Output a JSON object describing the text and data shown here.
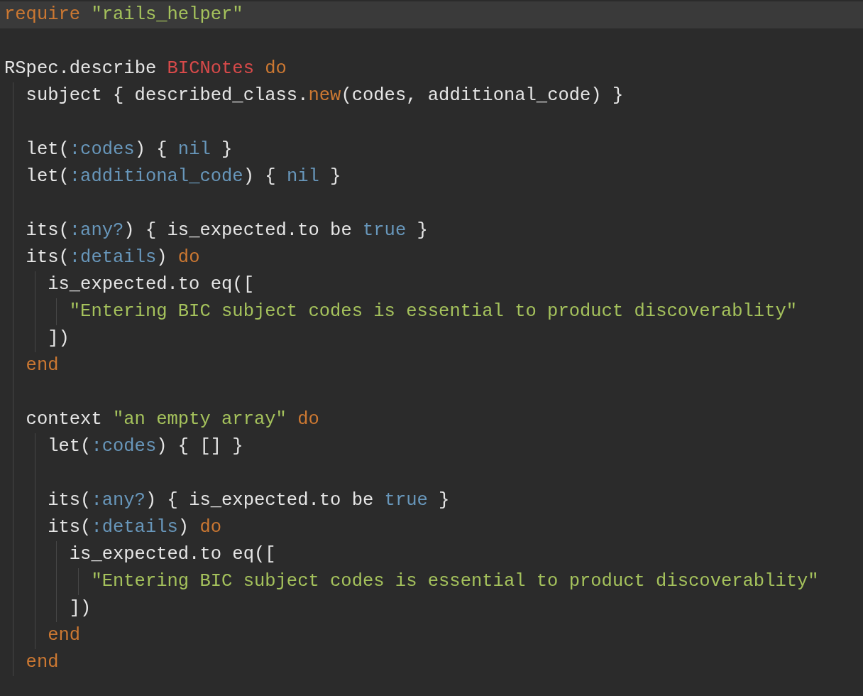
{
  "editor": {
    "lines": [
      {
        "kind": "code",
        "current": true,
        "tokens": [
          {
            "text": "require",
            "kind": "keyword"
          },
          {
            "text": " \"rails_helper\"",
            "kind": "string"
          }
        ]
      },
      {
        "kind": "blank",
        "current": false
      },
      {
        "kind": "code",
        "current": false,
        "tokens": [
          {
            "text": "RSpec.describe ",
            "kind": "plain"
          },
          {
            "text": "BICNotes",
            "kind": "class"
          },
          {
            "text": " do",
            "kind": "keyword"
          }
        ],
        "children": [
          {
            "kind": "code",
            "current": false,
            "tokens": [
              {
                "text": "subject { described_class.",
                "kind": "plain"
              },
              {
                "text": "new",
                "kind": "keyword"
              },
              {
                "text": "(codes, additional_code) }",
                "kind": "plain"
              }
            ]
          },
          {
            "kind": "blank",
            "current": false
          },
          {
            "kind": "code",
            "current": false,
            "tokens": [
              {
                "text": "let(",
                "kind": "plain"
              },
              {
                "text": ":codes",
                "kind": "symbol"
              },
              {
                "text": ") { ",
                "kind": "plain"
              },
              {
                "text": "nil",
                "kind": "symbol"
              },
              {
                "text": " }",
                "kind": "plain"
              }
            ]
          },
          {
            "kind": "code",
            "current": false,
            "tokens": [
              {
                "text": "let(",
                "kind": "plain"
              },
              {
                "text": ":additional_code",
                "kind": "symbol"
              },
              {
                "text": ") { ",
                "kind": "plain"
              },
              {
                "text": "nil",
                "kind": "symbol"
              },
              {
                "text": " }",
                "kind": "plain"
              }
            ]
          },
          {
            "kind": "blank",
            "current": false
          },
          {
            "kind": "code",
            "current": false,
            "tokens": [
              {
                "text": "its(",
                "kind": "plain"
              },
              {
                "text": ":any?",
                "kind": "symbol"
              },
              {
                "text": ") { is_expected.to be ",
                "kind": "plain"
              },
              {
                "text": "true",
                "kind": "symbol"
              },
              {
                "text": " }",
                "kind": "plain"
              }
            ]
          },
          {
            "kind": "code",
            "current": false,
            "tokens": [
              {
                "text": "its(",
                "kind": "plain"
              },
              {
                "text": ":details",
                "kind": "symbol"
              },
              {
                "text": ") ",
                "kind": "plain"
              },
              {
                "text": "do",
                "kind": "keyword"
              }
            ],
            "children": [
              {
                "kind": "code",
                "current": false,
                "tokens": [
                  {
                    "text": "is_expected.to eq([",
                    "kind": "plain"
                  }
                ],
                "children": [
                  {
                    "kind": "code",
                    "current": false,
                    "tokens": [
                      {
                        "text": "\"Entering BIC subject codes is essential to product discoverablity\"",
                        "kind": "string"
                      }
                    ]
                  }
                ]
              },
              {
                "kind": "code",
                "current": false,
                "tokens": [
                  {
                    "text": "])",
                    "kind": "plain"
                  }
                ]
              }
            ]
          },
          {
            "kind": "code",
            "current": false,
            "tokens": [
              {
                "text": "end",
                "kind": "keyword"
              }
            ]
          },
          {
            "kind": "blank",
            "current": false
          },
          {
            "kind": "code",
            "current": false,
            "tokens": [
              {
                "text": "context ",
                "kind": "plain"
              },
              {
                "text": "\"an empty array\"",
                "kind": "string"
              },
              {
                "text": " do",
                "kind": "keyword"
              }
            ],
            "children": [
              {
                "kind": "code",
                "current": false,
                "tokens": [
                  {
                    "text": "let(",
                    "kind": "plain"
                  },
                  {
                    "text": ":codes",
                    "kind": "symbol"
                  },
                  {
                    "text": ") { [] }",
                    "kind": "plain"
                  }
                ]
              },
              {
                "kind": "blank",
                "current": false
              },
              {
                "kind": "code",
                "current": false,
                "tokens": [
                  {
                    "text": "its(",
                    "kind": "plain"
                  },
                  {
                    "text": ":any?",
                    "kind": "symbol"
                  },
                  {
                    "text": ") { is_expected.to be ",
                    "kind": "plain"
                  },
                  {
                    "text": "true",
                    "kind": "symbol"
                  },
                  {
                    "text": " }",
                    "kind": "plain"
                  }
                ]
              },
              {
                "kind": "code",
                "current": false,
                "tokens": [
                  {
                    "text": "its(",
                    "kind": "plain"
                  },
                  {
                    "text": ":details",
                    "kind": "symbol"
                  },
                  {
                    "text": ") ",
                    "kind": "plain"
                  },
                  {
                    "text": "do",
                    "kind": "keyword"
                  }
                ],
                "children": [
                  {
                    "kind": "code",
                    "current": false,
                    "tokens": [
                      {
                        "text": "is_expected.to eq([",
                        "kind": "plain"
                      }
                    ],
                    "children": [
                      {
                        "kind": "code",
                        "current": false,
                        "tokens": [
                          {
                            "text": "\"Entering BIC subject codes is essential to product discoverablity\"",
                            "kind": "string"
                          }
                        ]
                      }
                    ]
                  },
                  {
                    "kind": "code",
                    "current": false,
                    "tokens": [
                      {
                        "text": "])",
                        "kind": "plain"
                      }
                    ]
                  }
                ]
              },
              {
                "kind": "code",
                "current": false,
                "tokens": [
                  {
                    "text": "end",
                    "kind": "keyword"
                  }
                ]
              }
            ]
          },
          {
            "kind": "code",
            "current": false,
            "tokens": [
              {
                "text": "end",
                "kind": "keyword"
              }
            ]
          }
        ]
      }
    ]
  }
}
